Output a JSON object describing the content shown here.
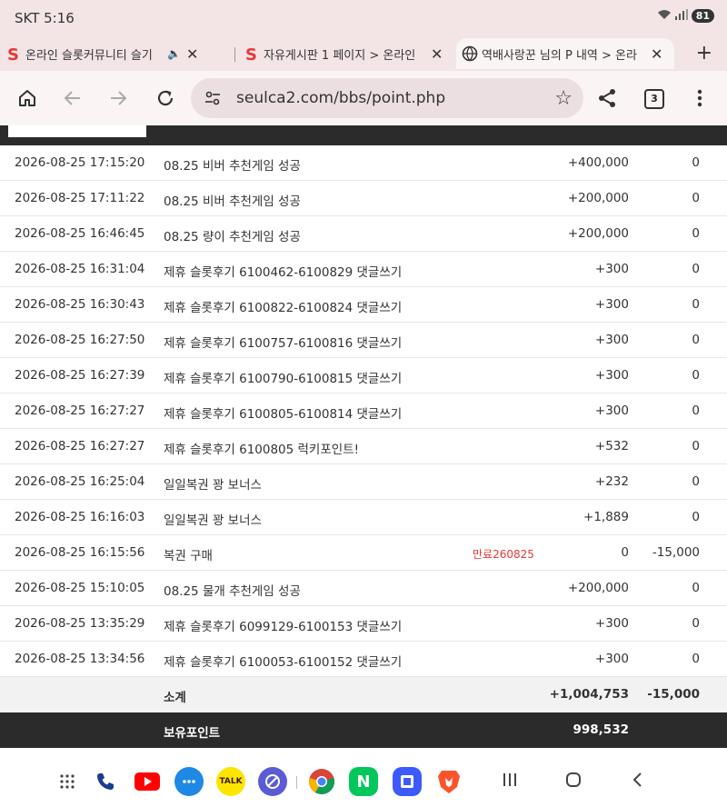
{
  "status_bar": {
    "carrier_time": "SKT 5:16",
    "battery": "81"
  },
  "tabs": [
    {
      "title": "온라인 슬롯커뮤니티 슬기"
    },
    {
      "title": "자유게시판 1 페이지 > 온라인"
    },
    {
      "title": "역배사랑꾼 님의 P 내역 > 온라"
    }
  ],
  "omnibox": {
    "url": "seulca2.com/bbs/point.php",
    "tab_count": "3"
  },
  "colors": {
    "accent_red": "#e53935",
    "dark_header": "#2b2b2b"
  },
  "table": {
    "rows": [
      {
        "date": "2026-08-25 17:15:20",
        "desc": "08.25 비버 추천게임 성공",
        "expiry": "",
        "points": "+400,000",
        "used": "0"
      },
      {
        "date": "2026-08-25 17:11:22",
        "desc": "08.25 비버 추천게임 성공",
        "expiry": "",
        "points": "+200,000",
        "used": "0"
      },
      {
        "date": "2026-08-25 16:46:45",
        "desc": "08.25 량이 추천게임 성공",
        "expiry": "",
        "points": "+200,000",
        "used": "0"
      },
      {
        "date": "2026-08-25 16:31:04",
        "desc": "제휴 슬롯후기 6100462-6100829 댓글쓰기",
        "expiry": "",
        "points": "+300",
        "used": "0"
      },
      {
        "date": "2026-08-25 16:30:43",
        "desc": "제휴 슬롯후기 6100822-6100824 댓글쓰기",
        "expiry": "",
        "points": "+300",
        "used": "0"
      },
      {
        "date": "2026-08-25 16:27:50",
        "desc": "제휴 슬롯후기 6100757-6100816 댓글쓰기",
        "expiry": "",
        "points": "+300",
        "used": "0"
      },
      {
        "date": "2026-08-25 16:27:39",
        "desc": "제휴 슬롯후기 6100790-6100815 댓글쓰기",
        "expiry": "",
        "points": "+300",
        "used": "0"
      },
      {
        "date": "2026-08-25 16:27:27",
        "desc": "제휴 슬롯후기 6100805-6100814 댓글쓰기",
        "expiry": "",
        "points": "+300",
        "used": "0"
      },
      {
        "date": "2026-08-25 16:27:27",
        "desc": "제휴 슬롯후기 6100805 럭키포인트!",
        "expiry": "",
        "points": "+532",
        "used": "0"
      },
      {
        "date": "2026-08-25 16:25:04",
        "desc": "일일복권 꽝 보너스",
        "expiry": "",
        "points": "+232",
        "used": "0"
      },
      {
        "date": "2026-08-25 16:16:03",
        "desc": "일일복권 꽝 보너스",
        "expiry": "",
        "points": "+1,889",
        "used": "0"
      },
      {
        "date": "2026-08-25 16:15:56",
        "desc": "복권 구매",
        "expiry": "만료260825",
        "points": "0",
        "used": "-15,000"
      },
      {
        "date": "2026-08-25 15:10:05",
        "desc": "08.25 물개 추천게임 성공",
        "expiry": "",
        "points": "+200,000",
        "used": "0"
      },
      {
        "date": "2026-08-25 13:35:29",
        "desc": "제휴 슬롯후기 6099129-6100153 댓글쓰기",
        "expiry": "",
        "points": "+300",
        "used": "0"
      },
      {
        "date": "2026-08-25 13:34:56",
        "desc": "제휴 슬롯후기 6100053-6100152 댓글쓰기",
        "expiry": "",
        "points": "+300",
        "used": "0"
      }
    ],
    "subtotal": {
      "label": "소계",
      "points": "+1,004,753",
      "used": "-15,000"
    },
    "total": {
      "label": "보유포인트",
      "points": "998,532"
    }
  },
  "navbar": {
    "apps": [
      "apps-grid",
      "phone",
      "youtube",
      "messages",
      "kakaotalk",
      "internet",
      "chrome",
      "naver",
      "samsung-notes",
      "brave"
    ],
    "kakaotalk_label": "TALK",
    "naver_label": "N"
  }
}
